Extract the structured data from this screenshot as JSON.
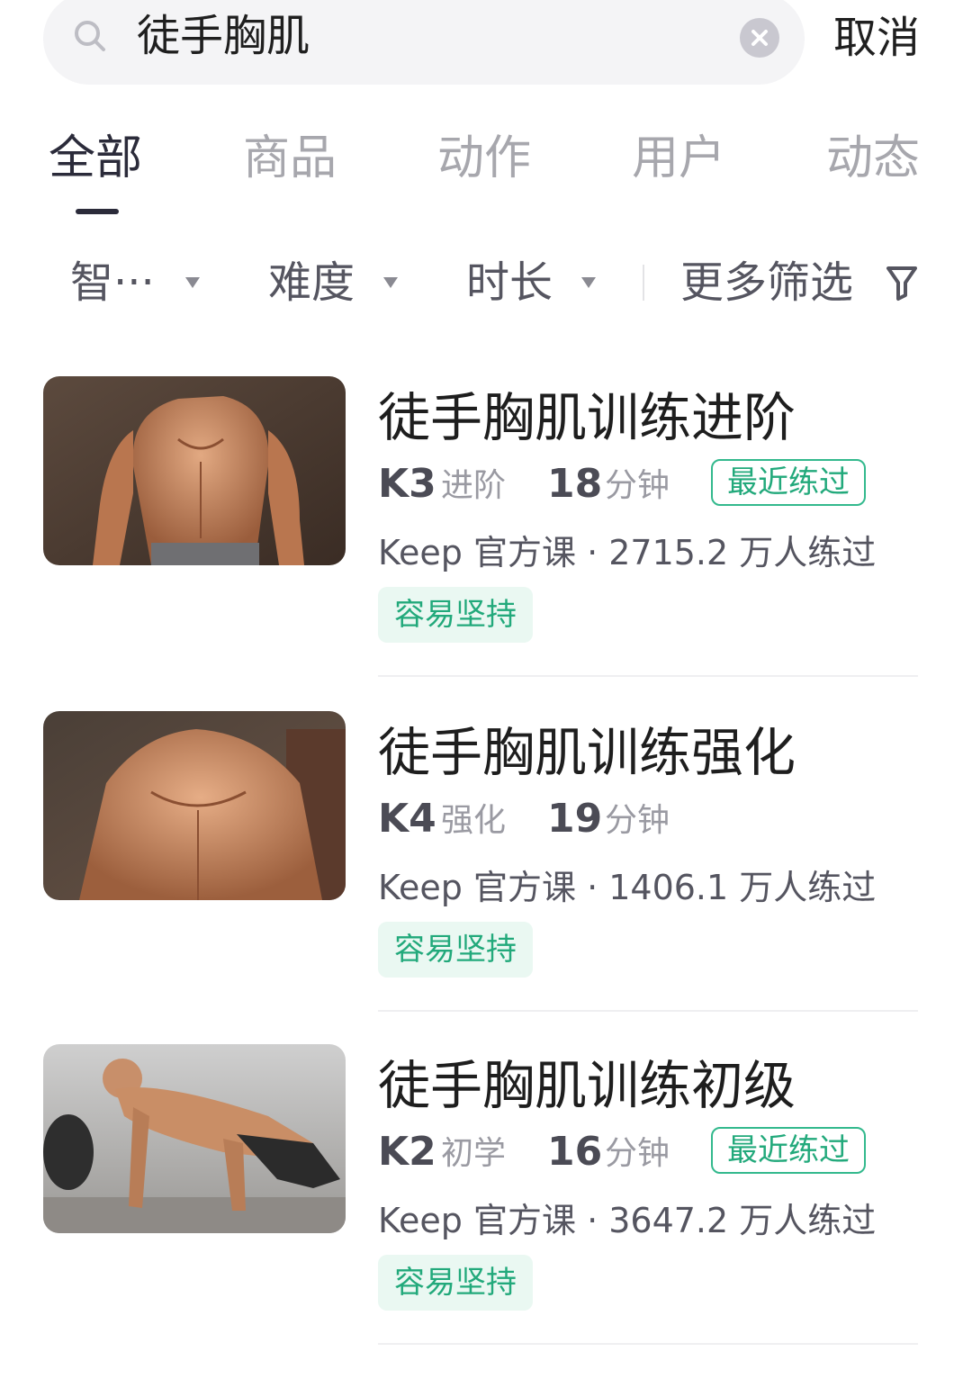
{
  "search": {
    "value": "徒手胸肌",
    "cancel_label": "取消"
  },
  "tabs": [
    {
      "label": "全部",
      "active": true
    },
    {
      "label": "商品",
      "active": false
    },
    {
      "label": "动作",
      "active": false
    },
    {
      "label": "用户",
      "active": false
    },
    {
      "label": "动态",
      "active": false
    }
  ],
  "filters": {
    "smart": "智···",
    "difficulty": "难度",
    "duration": "时长",
    "more": "更多筛选"
  },
  "courses": [
    {
      "title": "徒手胸肌训练进阶",
      "level_code": "K3",
      "level_name": "进阶",
      "duration": "18",
      "duration_unit": "分钟",
      "recent_badge": "最近练过",
      "source": "Keep 官方课 · 2715.2 万人练过",
      "tag": "容易坚持"
    },
    {
      "title": "徒手胸肌训练强化",
      "level_code": "K4",
      "level_name": "强化",
      "duration": "19",
      "duration_unit": "分钟",
      "source": "Keep 官方课 · 1406.1 万人练过",
      "tag": "容易坚持"
    },
    {
      "title": "徒手胸肌训练初级",
      "level_code": "K2",
      "level_name": "初学",
      "duration": "16",
      "duration_unit": "分钟",
      "recent_badge": "最近练过",
      "source": "Keep 官方课 · 3647.2 万人练过",
      "tag": "容易坚持"
    }
  ],
  "colors": {
    "accent_green": "#22a97b",
    "tag_bg": "#eaf8f2",
    "active_tab": "#2b2b3a",
    "inactive_tab": "#a7a7ad"
  }
}
